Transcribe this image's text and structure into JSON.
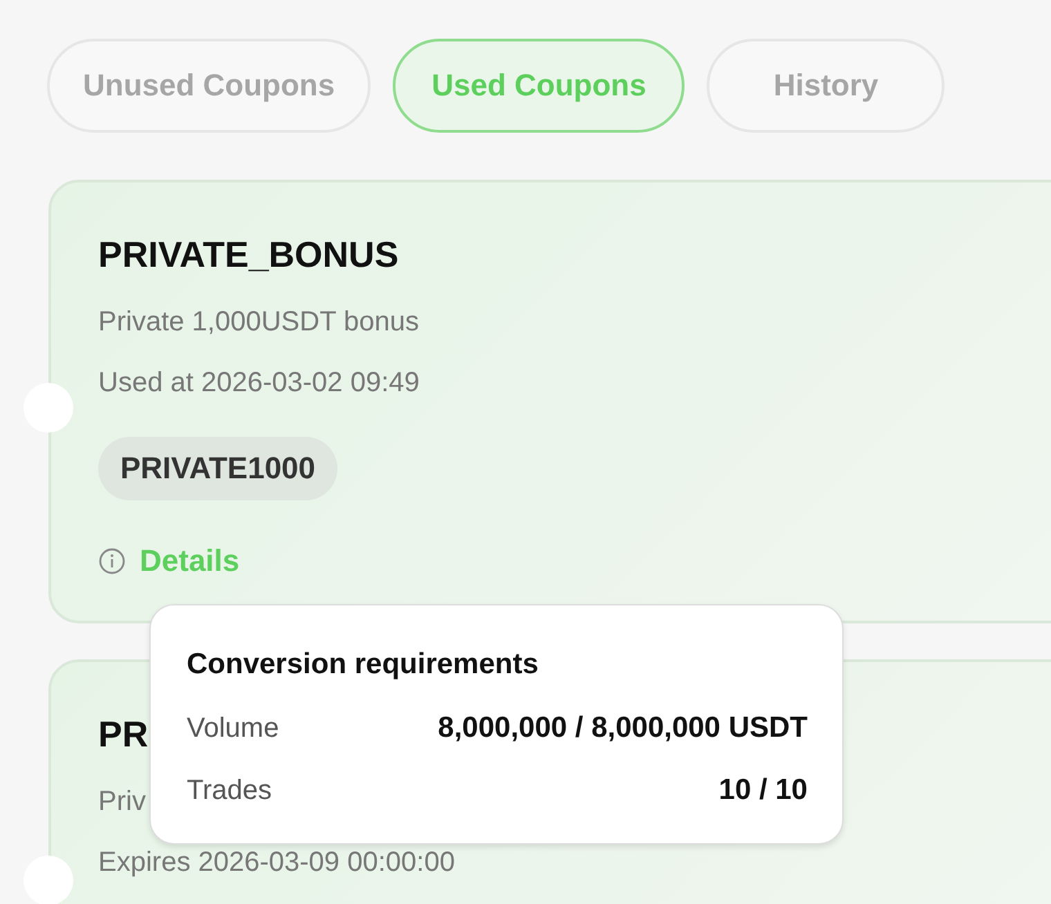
{
  "tabs": [
    {
      "label": "Unused Coupons",
      "selected": false
    },
    {
      "label": "Used Coupons",
      "selected": true
    },
    {
      "label": "History",
      "selected": false
    }
  ],
  "coupons": [
    {
      "title": "PRIVATE_BONUS",
      "description": "Private 1,000USDT bonus",
      "date_line": "Used at 2026-03-02 09:49",
      "code": "PRIVATE1000",
      "details_link": "Details"
    },
    {
      "title": "PR",
      "description": "Priv",
      "date_line": "Expires 2026-03-09 00:00:00"
    }
  ],
  "tooltip": {
    "title": "Conversion requirements",
    "rows": [
      {
        "label": "Volume",
        "value": "8,000,000 / 8,000,000 USDT"
      },
      {
        "label": "Trades",
        "value": "10 / 10"
      }
    ]
  }
}
